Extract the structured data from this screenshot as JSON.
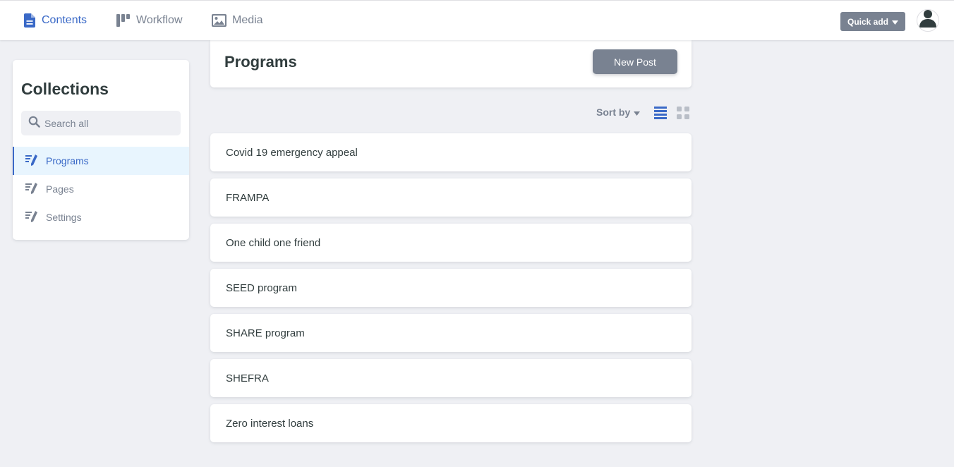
{
  "topbar": {
    "nav": [
      {
        "label": "Contents",
        "icon": "document-icon",
        "active": true
      },
      {
        "label": "Workflow",
        "icon": "workflow-icon",
        "active": false
      },
      {
        "label": "Media",
        "icon": "image-icon",
        "active": false
      }
    ],
    "quick_add_label": "Quick add",
    "avatar_icon": "user-icon"
  },
  "sidebar": {
    "title": "Collections",
    "search_placeholder": "Search all",
    "items": [
      {
        "label": "Programs",
        "icon": "write-icon",
        "active": true
      },
      {
        "label": "Pages",
        "icon": "write-icon",
        "active": false
      },
      {
        "label": "Settings",
        "icon": "write-icon",
        "active": false
      }
    ]
  },
  "main": {
    "title": "Programs",
    "new_post_label": "New Post",
    "sort_label": "Sort by",
    "view_modes": [
      "list-view-icon",
      "grid-view-icon"
    ],
    "active_view": "list",
    "entries": [
      "Covid 19 emergency appeal",
      "FRAMPA",
      "One child one friend",
      "SEED program",
      "SHARE program",
      "SHEFRA",
      "Zero interest loans"
    ]
  },
  "colors": {
    "accent": "#3a69c7",
    "muted": "#798291",
    "background": "#eff0f4",
    "text": "#313d3e",
    "active_bg": "#e8f5fe"
  }
}
